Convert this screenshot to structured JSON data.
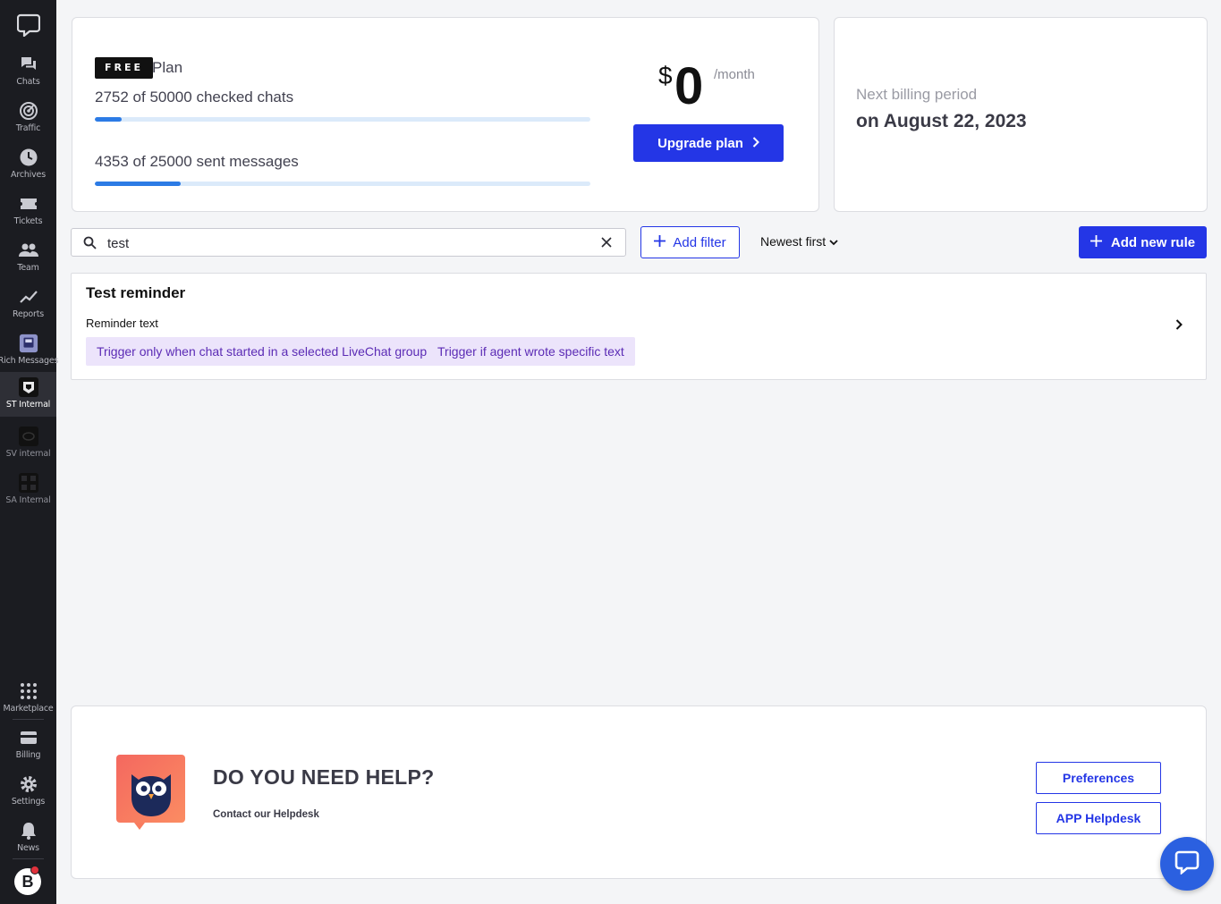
{
  "sidebar": {
    "logo_icon": "livechat-logo-icon",
    "items": [
      {
        "label": "Chats",
        "icon": "chat-bubbles-icon"
      },
      {
        "label": "Traffic",
        "icon": "traffic-icon"
      },
      {
        "label": "Archives",
        "icon": "clock-icon"
      },
      {
        "label": "Tickets",
        "icon": "ticket-icon"
      },
      {
        "label": "Team",
        "icon": "team-icon"
      },
      {
        "label": "Reports",
        "icon": "chart-line-icon"
      },
      {
        "label": "Rich Messages",
        "icon": "rich-messages-icon"
      },
      {
        "label": "ST Internal",
        "icon": "st-internal-icon"
      },
      {
        "label": "SV internal",
        "icon": "sv-internal-icon"
      },
      {
        "label": "SA Internal",
        "icon": "sa-internal-icon"
      }
    ],
    "bottom_items": [
      {
        "label": "Marketplace",
        "icon": "grid-icon"
      },
      {
        "label": "Billing",
        "icon": "card-icon"
      },
      {
        "label": "Settings",
        "icon": "gear-icon"
      },
      {
        "label": "News",
        "icon": "bell-icon"
      }
    ],
    "avatar_letter": "B"
  },
  "plan": {
    "badge": "FREE",
    "name": "Plan",
    "usage": [
      {
        "text": "2752 of 50000 checked chats",
        "used": 2752,
        "limit": 50000
      },
      {
        "text": "4353 of 25000 sent messages",
        "used": 4353,
        "limit": 25000
      }
    ],
    "currency": "$",
    "price": "0",
    "period": "/month",
    "upgrade_label": "Upgrade plan"
  },
  "billing": {
    "label": "Next billing period",
    "date": "on August 22, 2023"
  },
  "toolbar": {
    "search_value": "test",
    "add_filter_label": "Add filter",
    "sort_label": "Newest first",
    "add_rule_label": "Add new rule"
  },
  "rules": [
    {
      "title": "Test reminder",
      "subtitle": "Reminder text",
      "tags": [
        "Trigger only when chat started in a selected LiveChat group",
        "Trigger if agent wrote specific text"
      ]
    }
  ],
  "help": {
    "title": "DO YOU NEED HELP?",
    "subtitle": "Contact our Helpdesk",
    "preferences_label": "Preferences",
    "helpdesk_label": "APP Helpdesk"
  },
  "colors": {
    "accent": "#2436e6",
    "sidebar_bg": "#1b1c21",
    "progress": "#2c7be5",
    "tag_bg": "#ece4fb",
    "tag_text": "#5b2bb5"
  }
}
